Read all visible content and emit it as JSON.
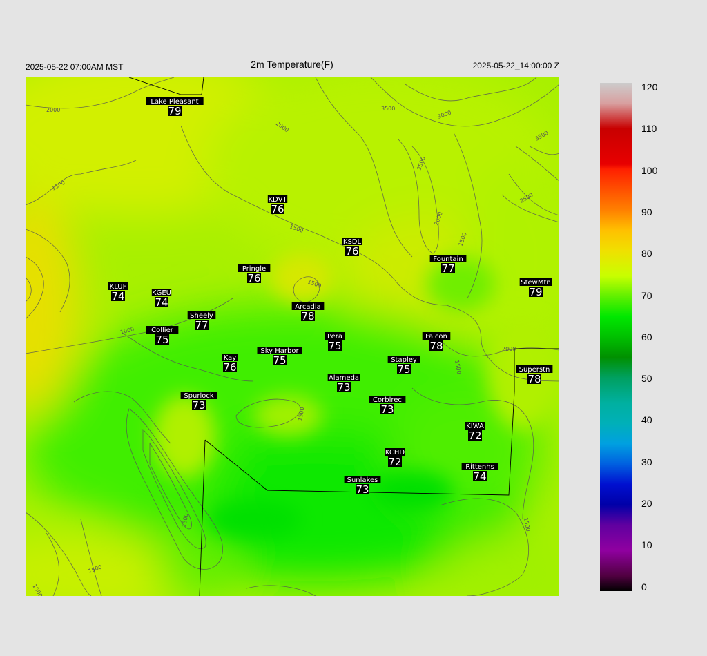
{
  "header": {
    "valid_local": "2025-05-22 07:00AM MST",
    "title": "2m Temperature(F)",
    "valid_utc": "2025-05-22_14:00:00 Z"
  },
  "stations": [
    {
      "name": "Lake Pleasant",
      "value": "79"
    },
    {
      "name": "KDVT",
      "value": "76"
    },
    {
      "name": "KSDL",
      "value": "76"
    },
    {
      "name": "Fountain",
      "value": "77"
    },
    {
      "name": "Pringle",
      "value": "76"
    },
    {
      "name": "StewMtn",
      "value": "79"
    },
    {
      "name": "KLUF",
      "value": "74"
    },
    {
      "name": "KGEU",
      "value": "74"
    },
    {
      "name": "Arcadia",
      "value": "78"
    },
    {
      "name": "Sheely",
      "value": "77"
    },
    {
      "name": "Collier",
      "value": "75"
    },
    {
      "name": "Pera",
      "value": "75"
    },
    {
      "name": "Falcon",
      "value": "78"
    },
    {
      "name": "Sky Harbor",
      "value": "75"
    },
    {
      "name": "Kay",
      "value": "76"
    },
    {
      "name": "Stapley",
      "value": "75"
    },
    {
      "name": "Superstn",
      "value": "78"
    },
    {
      "name": "Alameda",
      "value": "73"
    },
    {
      "name": "Spurlock",
      "value": "73"
    },
    {
      "name": "Corblrec",
      "value": "73"
    },
    {
      "name": "KIWA",
      "value": "72"
    },
    {
      "name": "KCHD",
      "value": "72"
    },
    {
      "name": "Rittenhs",
      "value": "74"
    },
    {
      "name": "Sunlakes",
      "value": "73"
    }
  ],
  "contour_labels": [
    "2000",
    "2000",
    "3500",
    "3000",
    "3500",
    "1500",
    "2500",
    "2000",
    "2500",
    "1500",
    "1500",
    "1500",
    "1000",
    "2000",
    "1500",
    "1500",
    "1500",
    "1500",
    "1500",
    "1500"
  ],
  "colorbar": {
    "ticks": [
      "120",
      "110",
      "100",
      "90",
      "80",
      "70",
      "60",
      "50",
      "40",
      "30",
      "20",
      "10",
      "0"
    ],
    "colors": {
      "v120": "#c8c8c8",
      "v110": "#e00000",
      "v100": "#ff2a00",
      "v90": "#ffc800",
      "v80": "#c8ff00",
      "v70": "#00e000",
      "v60": "#00a000",
      "v50": "#00b4a0",
      "v40": "#00b4c8",
      "v30": "#0070e0",
      "v20": "#0000c0",
      "v10": "#8000a0",
      "v0": "#000000"
    }
  }
}
